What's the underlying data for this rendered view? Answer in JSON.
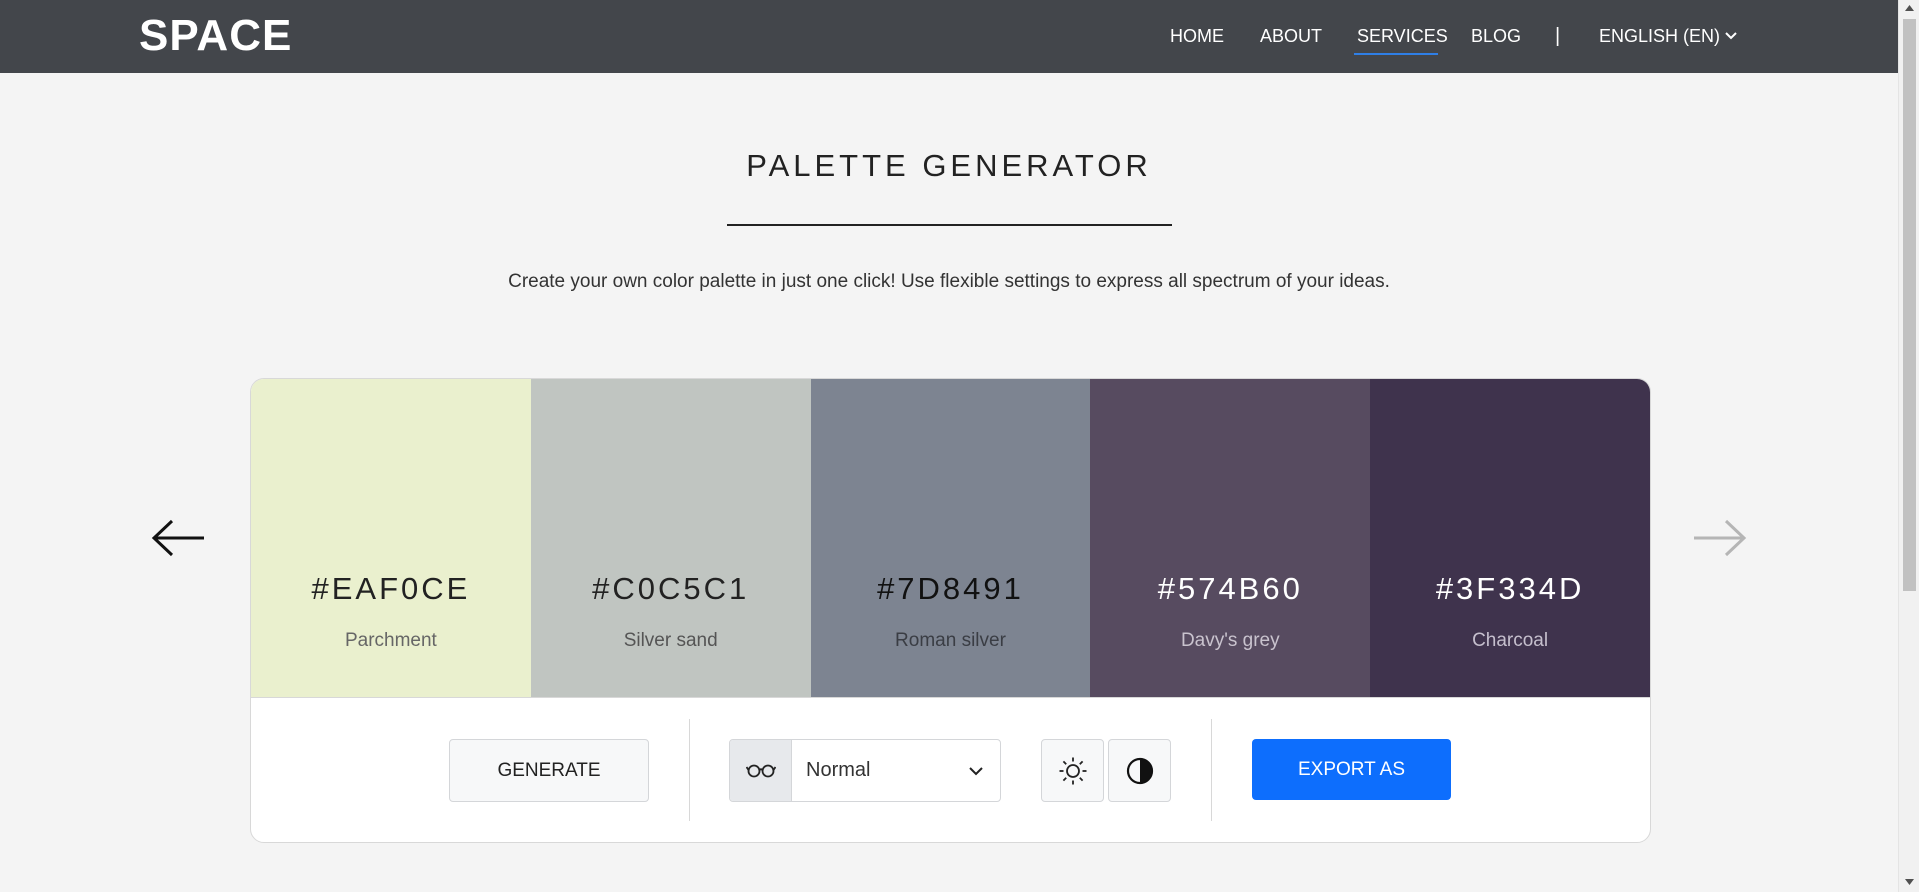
{
  "navbar": {
    "brand": "SPACE",
    "items": [
      {
        "label": "HOME"
      },
      {
        "label": "ABOUT"
      },
      {
        "label": "SERVICES",
        "active": true
      },
      {
        "label": "BLOG"
      }
    ],
    "separator": "|",
    "language": "ENGLISH (EN)"
  },
  "header": {
    "title": "PALETTE GENERATOR",
    "subtitle": "Create your own color palette in just one click! Use flexible settings to express all spectrum of your ideas."
  },
  "palette": {
    "swatches": [
      {
        "hex": "#EAF0CE",
        "name": "Parchment",
        "color": "#EAF0CE",
        "text_color": "#222222",
        "name_color": "#666666"
      },
      {
        "hex": "#C0C5C1",
        "name": "Silver sand",
        "color": "#C0C5C1",
        "text_color": "#222222",
        "name_color": "#555555"
      },
      {
        "hex": "#7D8491",
        "name": "Roman silver",
        "color": "#7D8491",
        "text_color": "#111111",
        "name_color": "#3a3d44"
      },
      {
        "hex": "#574B60",
        "name": "Davy's grey",
        "color": "#574B60",
        "text_color": "#ffffff",
        "name_color": "#c9c3ce"
      },
      {
        "hex": "#3F334D",
        "name": "Charcoal",
        "color": "#3F334D",
        "text_color": "#ffffff",
        "name_color": "#c5bfcd"
      }
    ]
  },
  "toolbar": {
    "generate_label": "GENERATE",
    "vision_mode": "Normal",
    "export_label": "EXPORT AS"
  },
  "colors": {
    "navbar_bg": "#43464B",
    "accent": "#0D6EFD",
    "page_bg": "#F4F4F4"
  },
  "icons": {
    "back": "arrow-left-icon",
    "forward": "arrow-right-icon",
    "vision": "glasses-icon",
    "brightness": "sun-icon",
    "contrast": "contrast-icon",
    "language_toggle": "chevron-down-icon"
  }
}
